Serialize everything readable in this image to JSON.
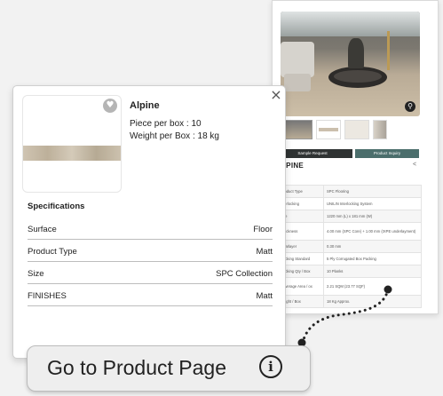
{
  "background_page": {
    "sample_button": "Sample Request",
    "inquiry_button": "Product Inquiry",
    "title": "LPINE",
    "share_icon": "share-icon",
    "specs": [
      {
        "key": "roduct Type",
        "value": "SPC Flooring"
      },
      {
        "key": "terlocking",
        "value": "UNILIN Interlocking System"
      },
      {
        "key": "ze",
        "value": "1220 mm (L) x 181 mm (W)"
      },
      {
        "key": "hickness",
        "value": "4.00 mm (SPC Core) + 1.00 mm (IXPE underlayment)"
      },
      {
        "key": "earlayer",
        "value": "0.30 mm"
      },
      {
        "key": "acking Standard",
        "value": "5 Ply Corrugated Box Packing"
      },
      {
        "key": "acking Qty / Box",
        "value": "10 Planks"
      },
      {
        "key": "overage Area / ox",
        "value": "2.21 SQM (23.77 SQF)"
      },
      {
        "key": "eight / Box",
        "value": "18 Kg Approx."
      }
    ]
  },
  "popup": {
    "title": "Alpine",
    "piece_per_box": "Piece per box : 10",
    "weight_per_box": "Weight per Box : 18 kg",
    "close_icon": "close-icon",
    "favorite_icon": "heart-icon",
    "specs_heading": "Specifications",
    "specs": [
      {
        "label": "Surface",
        "value": "Floor"
      },
      {
        "label": "Product Type",
        "value": "Matt"
      },
      {
        "label": "Size",
        "value": "SPC Collection"
      },
      {
        "label": "FINISHES",
        "value": "Matt"
      }
    ]
  },
  "cta": {
    "label": "Go to Product Page",
    "icon": "info-icon"
  },
  "colors": {
    "sample_button": "#2f3333",
    "inquiry_button": "#4b6e6c",
    "cta_background": "#eeeeee"
  }
}
